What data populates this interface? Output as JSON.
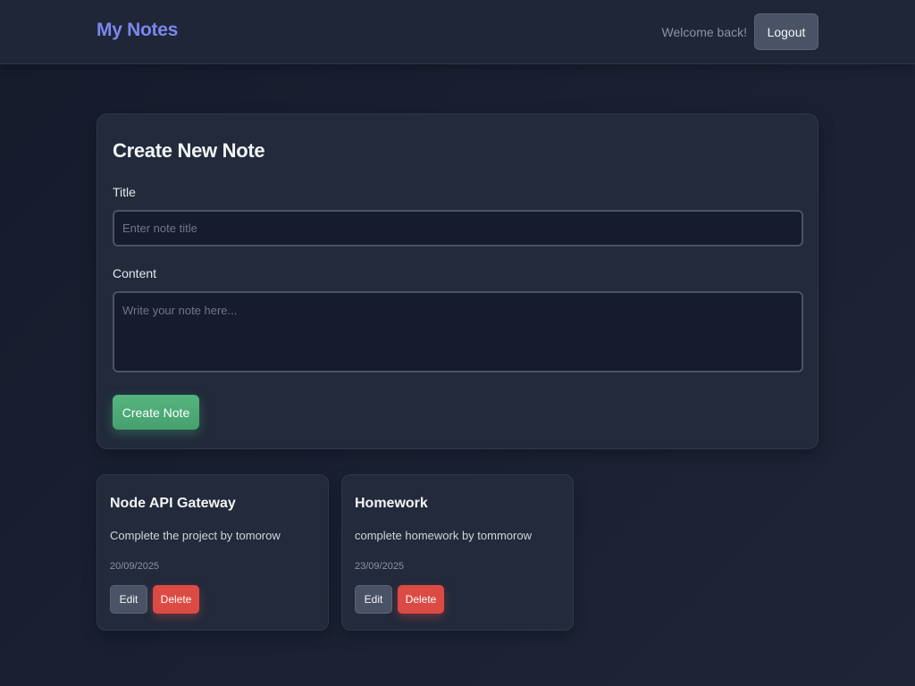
{
  "header": {
    "brand": "My Notes",
    "welcome": "Welcome back!",
    "logout_label": "Logout"
  },
  "create_form": {
    "heading": "Create New Note",
    "title_label": "Title",
    "title_placeholder": "Enter note title",
    "title_value": "",
    "content_label": "Content",
    "content_placeholder": "Write your note here...",
    "content_value": "",
    "submit_label": "Create Note"
  },
  "notes": [
    {
      "title": "Node API Gateway",
      "content": "Complete the project by tomorow",
      "date": "20/09/2025",
      "edit_label": "Edit",
      "delete_label": "Delete"
    },
    {
      "title": "Homework",
      "content": "complete homework by tommorow",
      "date": "23/09/2025",
      "edit_label": "Edit",
      "delete_label": "Delete"
    }
  ],
  "colors": {
    "brand": "#7b87f0",
    "primary_action": "#48bb78",
    "danger": "#dc4a44",
    "background": "#1a2030",
    "card": "#222a3b"
  }
}
